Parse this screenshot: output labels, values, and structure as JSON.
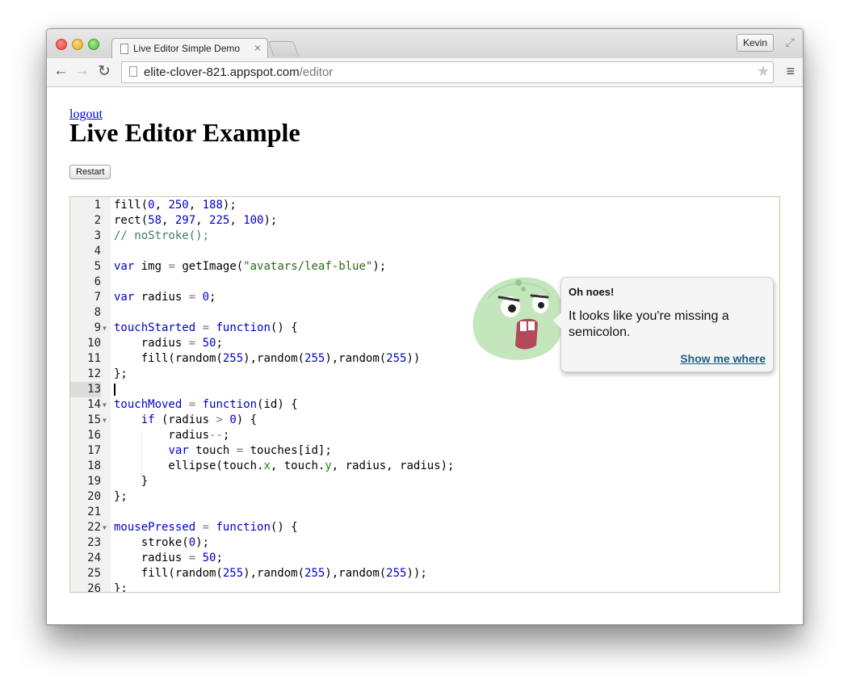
{
  "browser": {
    "tab_title": "Live Editor Simple Demo",
    "tab_close": "×",
    "profile_name": "Kevin",
    "url_host": "elite-clover-821.appspot.com",
    "url_path": "/editor",
    "icons": {
      "back": "←",
      "forward": "→",
      "reload": "↻",
      "star": "★",
      "menu": "≡",
      "fullscreen": "⤢"
    }
  },
  "page": {
    "logout_label": "logout",
    "title": "Live Editor Example",
    "restart_label": "Restart"
  },
  "editor": {
    "active_line": 13,
    "lines": [
      {
        "num": "1",
        "code": "fill(0, 250, 188);"
      },
      {
        "num": "2",
        "code": "rect(58, 297, 225, 100);"
      },
      {
        "num": "3",
        "code": "// noStroke();"
      },
      {
        "num": "4",
        "code": ""
      },
      {
        "num": "5",
        "code": "var img = getImage(\"avatars/leaf-blue\");"
      },
      {
        "num": "6",
        "code": ""
      },
      {
        "num": "7",
        "code": "var radius = 0;"
      },
      {
        "num": "8",
        "code": ""
      },
      {
        "num": "9",
        "code": "touchStarted = function() {",
        "fold": true
      },
      {
        "num": "10",
        "code": "    radius = 50;"
      },
      {
        "num": "11",
        "code": "    fill(random(255),random(255),random(255))"
      },
      {
        "num": "12",
        "code": "};"
      },
      {
        "num": "13",
        "code": ""
      },
      {
        "num": "14",
        "code": "touchMoved = function(id) {",
        "fold": true
      },
      {
        "num": "15",
        "code": "    if (radius > 0) {",
        "fold": true
      },
      {
        "num": "16",
        "code": "        radius--;"
      },
      {
        "num": "17",
        "code": "        var touch = touches[id];"
      },
      {
        "num": "18",
        "code": "        ellipse(touch.x, touch.y, radius, radius);"
      },
      {
        "num": "19",
        "code": "    }"
      },
      {
        "num": "20",
        "code": "};"
      },
      {
        "num": "21",
        "code": ""
      },
      {
        "num": "22",
        "code": "mousePressed = function() {",
        "fold": true
      },
      {
        "num": "23",
        "code": "    stroke(0);"
      },
      {
        "num": "24",
        "code": "    radius = 50;"
      },
      {
        "num": "25",
        "code": "    fill(random(255),random(255),random(255));"
      },
      {
        "num": "26",
        "code": "};"
      }
    ]
  },
  "error_bubble": {
    "title": "Oh noes!",
    "message": "It looks like you're missing a semicolon.",
    "link_label": "Show me where"
  },
  "colors": {
    "keyword": "#0000cc",
    "string": "#2b6a17",
    "comment": "#3f7f5f",
    "link": "#1b5e80"
  }
}
